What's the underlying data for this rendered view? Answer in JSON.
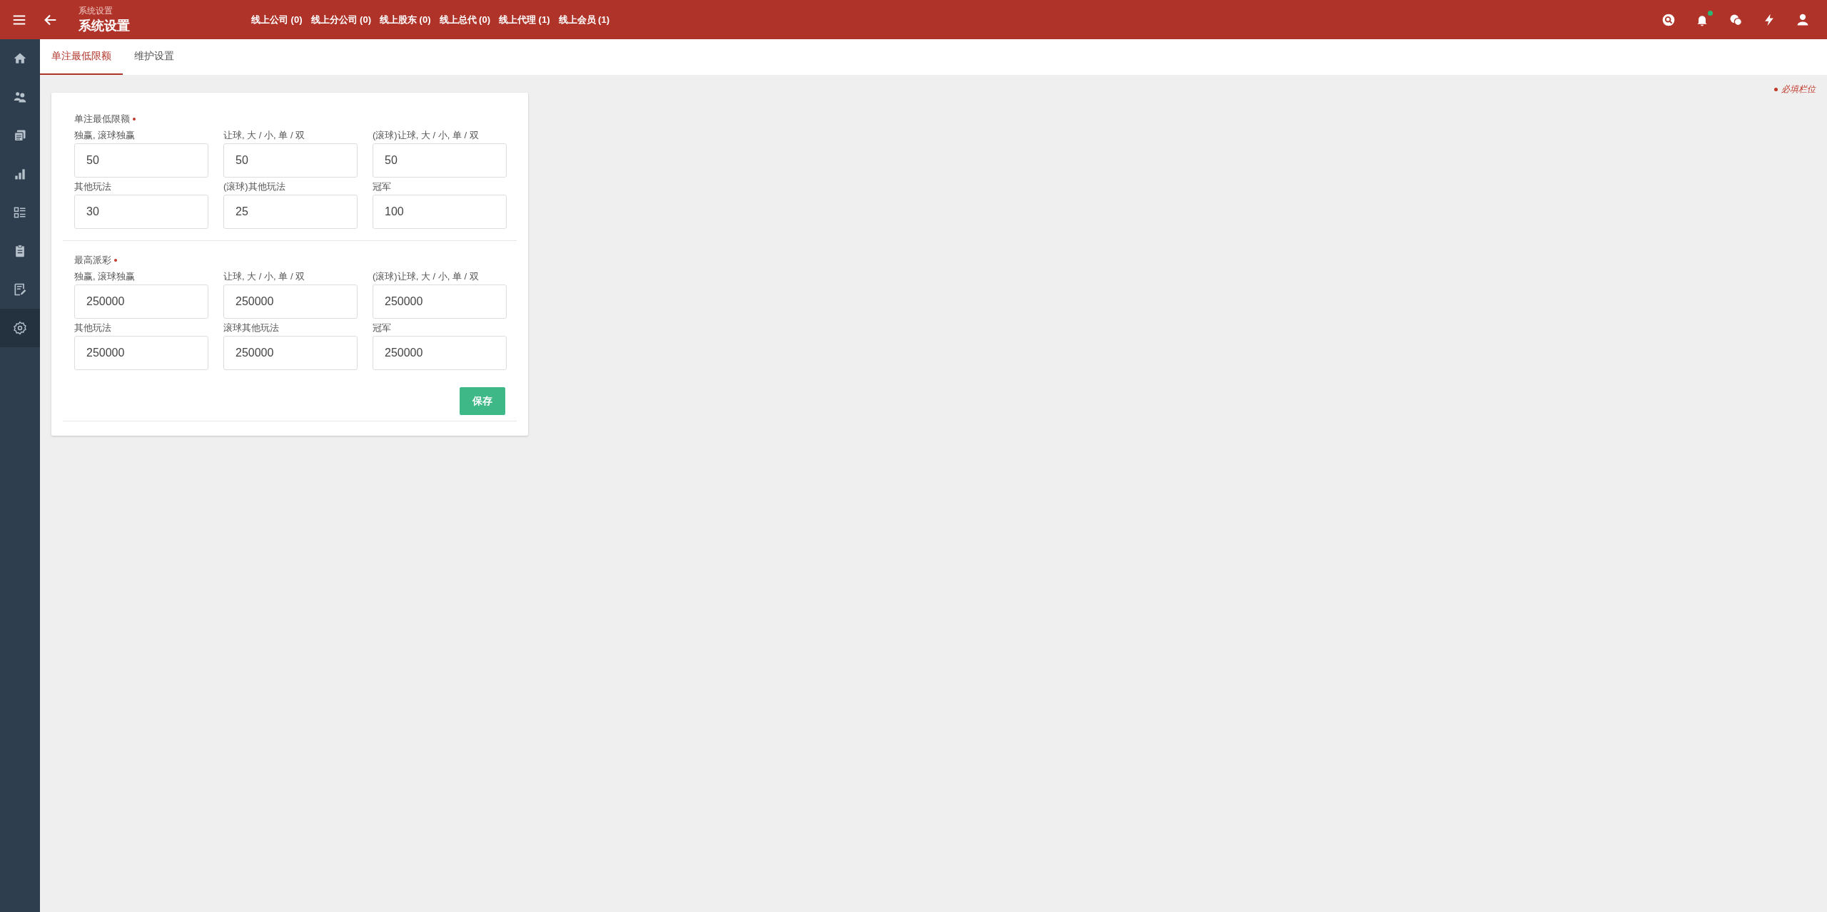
{
  "header": {
    "breadcrumb": "系统设置",
    "title": "系统设置",
    "online_counts": [
      "线上公司 (0)",
      "线上分公司 (0)",
      "线上股东 (0)",
      "线上总代 (0)",
      "线上代理 (1)",
      "线上会员 (1)"
    ],
    "actions": [
      {
        "kind": "search",
        "unread": false
      },
      {
        "kind": "bell",
        "unread": true
      },
      {
        "kind": "chat",
        "unread": false
      },
      {
        "kind": "bolt",
        "unread": false
      },
      {
        "kind": "user",
        "unread": false
      }
    ]
  },
  "sidebar": {
    "items": [
      {
        "kind": "home",
        "selected": false
      },
      {
        "kind": "users",
        "selected": false
      },
      {
        "kind": "copies",
        "selected": false
      },
      {
        "kind": "chart",
        "selected": false
      },
      {
        "kind": "list",
        "selected": false
      },
      {
        "kind": "clipboard",
        "selected": false
      },
      {
        "kind": "note",
        "selected": false
      },
      {
        "kind": "gear",
        "selected": true
      }
    ]
  },
  "tabs": [
    {
      "label": "单注最低限额",
      "selected": true
    },
    {
      "label": "维护设置",
      "selected": false
    }
  ],
  "required_note": "必填栏位",
  "sections": [
    {
      "title": "单注最低限额",
      "required": true,
      "fields": [
        {
          "label": "独赢, 滚球独赢",
          "value": "50"
        },
        {
          "label": "让球, 大 / 小, 单 / 双",
          "value": "50"
        },
        {
          "label": "(滚球)让球, 大 / 小, 单 / 双",
          "value": "50"
        },
        {
          "label": "其他玩法",
          "value": "30"
        },
        {
          "label": "(滚球)其他玩法",
          "value": "25"
        },
        {
          "label": "冠军",
          "value": "100"
        }
      ]
    },
    {
      "title": "最高派彩",
      "required": true,
      "fields": [
        {
          "label": "独赢, 滚球独赢",
          "value": "250000"
        },
        {
          "label": "让球, 大 / 小, 单 / 双",
          "value": "250000"
        },
        {
          "label": "(滚球)让球, 大 / 小, 单 / 双",
          "value": "250000"
        },
        {
          "label": "其他玩法",
          "value": "250000"
        },
        {
          "label": "滚球其他玩法",
          "value": "250000"
        },
        {
          "label": "冠军",
          "value": "250000"
        }
      ]
    }
  ],
  "save_button": "保存"
}
